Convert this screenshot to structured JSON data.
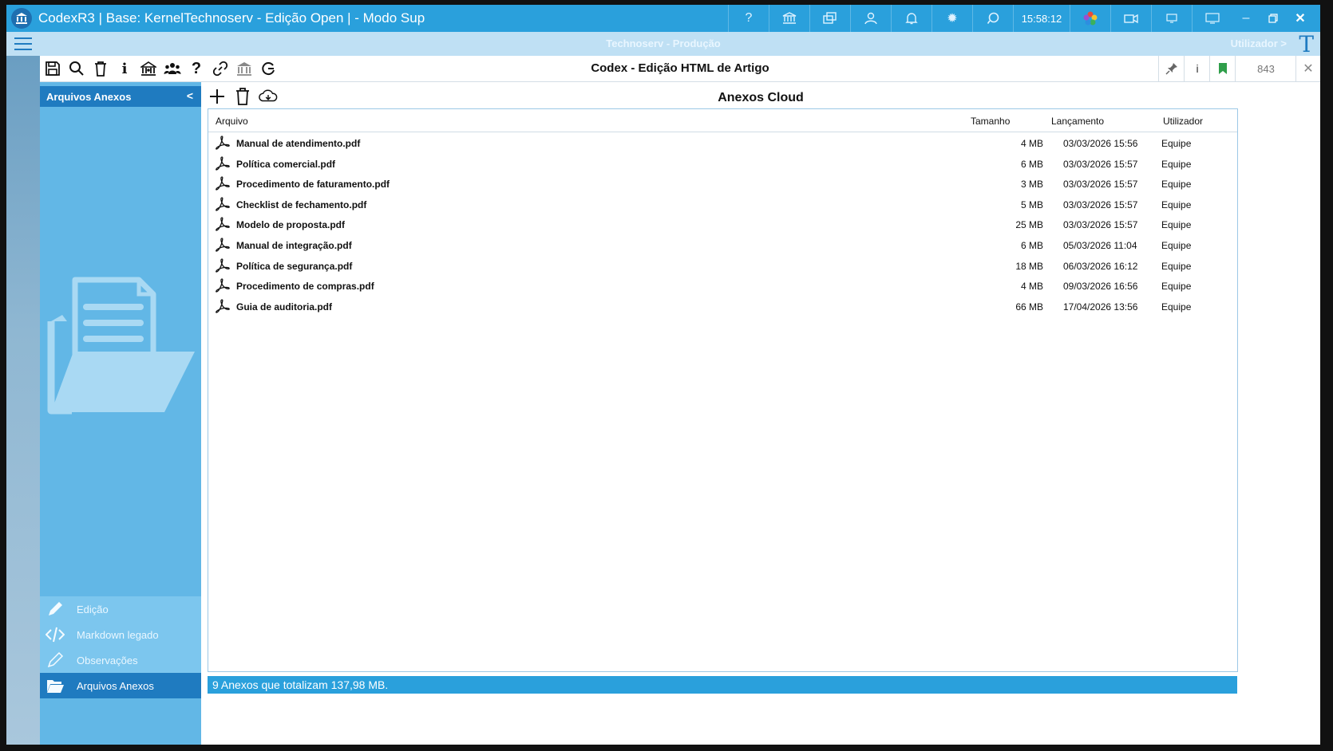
{
  "titlebar": {
    "title": "CodexR3 | Base: KernelTechnoserv - Edição Open | - Modo Sup",
    "time": "15:58:12",
    "icons": [
      "help-icon",
      "bank-icon",
      "windows-icon",
      "user-icon",
      "bell-icon",
      "gear-icon",
      "chat-icon",
      "color-wheel-icon",
      "camera-icon",
      "monitor-small-icon",
      "monitor-icon"
    ],
    "window_controls": [
      "minimize-icon",
      "restore-icon",
      "close-icon"
    ]
  },
  "subbar": {
    "environment": "Technoserv - Produção",
    "user": "Utilizador >",
    "logo": "T"
  },
  "toolbar": {
    "window_title": "Codex - Edição HTML de Artigo",
    "record_number": "843",
    "tools": [
      "save-icon",
      "search-icon",
      "delete-icon",
      "info-icon",
      "home-icon",
      "users-icon",
      "help-icon",
      "link-icon",
      "bank-icon",
      "refresh-icon"
    ]
  },
  "sidepanel": {
    "header": "Arquivos Anexos",
    "collapse": "<",
    "nav": [
      {
        "label": "Edição",
        "icon": "pencil-icon"
      },
      {
        "label": "Markdown legado",
        "icon": "code-icon"
      },
      {
        "label": "Observações",
        "icon": "edit-icon"
      },
      {
        "label": "Arquivos Anexos",
        "icon": "folder-icon",
        "active": true
      }
    ]
  },
  "main": {
    "title": "Anexos Cloud",
    "tools": [
      "add-icon",
      "delete-icon",
      "cloud-download-icon"
    ],
    "columns": {
      "file": "Arquivo",
      "size": "Tamanho",
      "date": "Lançamento",
      "user": "Utilizador"
    },
    "rows": [
      {
        "name": "Manual de atendimento.pdf",
        "size": "4 MB",
        "date": "03/03/2026 15:56",
        "user": "Equipe"
      },
      {
        "name": "Política comercial.pdf",
        "size": "6 MB",
        "date": "03/03/2026 15:57",
        "user": "Equipe"
      },
      {
        "name": "Procedimento de faturamento.pdf",
        "size": "3 MB",
        "date": "03/03/2026 15:57",
        "user": "Equipe"
      },
      {
        "name": "Checklist de fechamento.pdf",
        "size": "5 MB",
        "date": "03/03/2026 15:57",
        "user": "Equipe"
      },
      {
        "name": "Modelo de proposta.pdf",
        "size": "25 MB",
        "date": "03/03/2026 15:57",
        "user": "Equipe"
      },
      {
        "name": "Manual de integração.pdf",
        "size": "6 MB",
        "date": "05/03/2026 11:04",
        "user": "Equipe"
      },
      {
        "name": "Política de segurança.pdf",
        "size": "18 MB",
        "date": "06/03/2026 16:12",
        "user": "Equipe"
      },
      {
        "name": "Procedimento de compras.pdf",
        "size": "4 MB",
        "date": "09/03/2026 16:56",
        "user": "Equipe"
      },
      {
        "name": "Guia de auditoria.pdf",
        "size": "66 MB",
        "date": "17/04/2026 13:56",
        "user": "Equipe"
      }
    ],
    "status": "9 Anexos que totalizam 137,98 MB."
  }
}
